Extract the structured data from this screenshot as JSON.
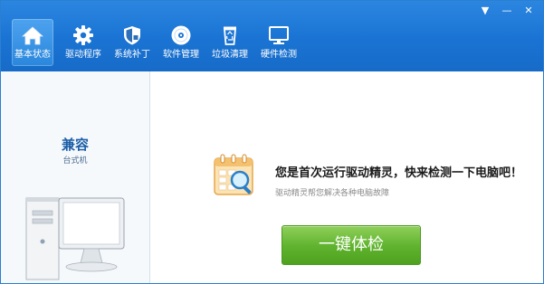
{
  "window_controls": {
    "menu": "▼",
    "minimize": "—",
    "close": "✕"
  },
  "nav": {
    "items": [
      {
        "label": "基本状态",
        "icon": "home-icon"
      },
      {
        "label": "驱动程序",
        "icon": "gear-icon"
      },
      {
        "label": "系统补丁",
        "icon": "shield-icon"
      },
      {
        "label": "软件管理",
        "icon": "disc-icon"
      },
      {
        "label": "垃圾清理",
        "icon": "recycle-bin-icon"
      },
      {
        "label": "硬件检测",
        "icon": "monitor-icon"
      }
    ],
    "active_index": 0
  },
  "sidebar": {
    "title": "兼容",
    "subtitle": "台式机",
    "image": "desktop-computer-icon"
  },
  "main": {
    "title": "您是首次运行驱动精灵，快来检测一下电脑吧！",
    "subtitle": "驱动精灵帮您解决各种电脑故障",
    "button_label": "一键体检",
    "icon": "calendar-search-icon"
  },
  "colors": {
    "topbar": "#1a73d3",
    "button": "#5eb22d",
    "title_blue": "#1c5ea7"
  }
}
